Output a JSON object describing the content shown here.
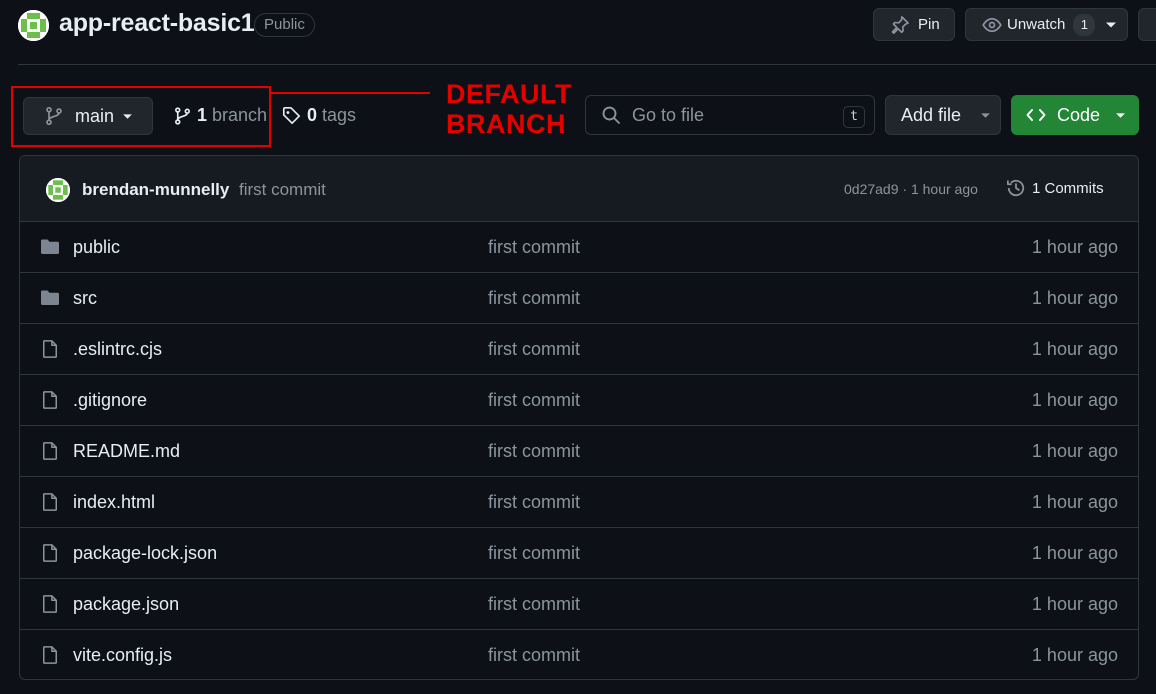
{
  "header": {
    "repo_name": "app-react-basic1",
    "visibility": "Public",
    "pin_label": "Pin",
    "watch_label": "Unwatch",
    "watch_count": "1"
  },
  "branch_bar": {
    "current_branch": "main",
    "branch_count": "1",
    "branch_word": "branch",
    "tag_count": "0",
    "tag_word": "tags"
  },
  "annotation": {
    "line1": "DEFAULT",
    "line2": "BRANCH",
    "color": "#e50000"
  },
  "search": {
    "placeholder": "Go to file",
    "shortcut": "t"
  },
  "actions": {
    "add_file": "Add file",
    "code": "Code"
  },
  "latest_commit": {
    "author": "brendan-munnelly",
    "message": "first commit",
    "meta": "0d27ad9 · 1 hour ago",
    "commits_label": "1 Commits"
  },
  "files": [
    {
      "name": "public",
      "type": "folder",
      "message": "first commit",
      "age": "1 hour ago"
    },
    {
      "name": "src",
      "type": "folder",
      "message": "first commit",
      "age": "1 hour ago"
    },
    {
      "name": ".eslintrc.cjs",
      "type": "file",
      "message": "first commit",
      "age": "1 hour ago"
    },
    {
      "name": ".gitignore",
      "type": "file",
      "message": "first commit",
      "age": "1 hour ago"
    },
    {
      "name": "README.md",
      "type": "file",
      "message": "first commit",
      "age": "1 hour ago"
    },
    {
      "name": "index.html",
      "type": "file",
      "message": "first commit",
      "age": "1 hour ago"
    },
    {
      "name": "package-lock.json",
      "type": "file",
      "message": "first commit",
      "age": "1 hour ago"
    },
    {
      "name": "package.json",
      "type": "file",
      "message": "first commit",
      "age": "1 hour ago"
    },
    {
      "name": "vite.config.js",
      "type": "file",
      "message": "first commit",
      "age": "1 hour ago"
    }
  ],
  "colors": {
    "background": "#0d1117",
    "code_button": "#238636",
    "folder_icon": "#7d8590",
    "avatar_green": "#6cc04a"
  }
}
